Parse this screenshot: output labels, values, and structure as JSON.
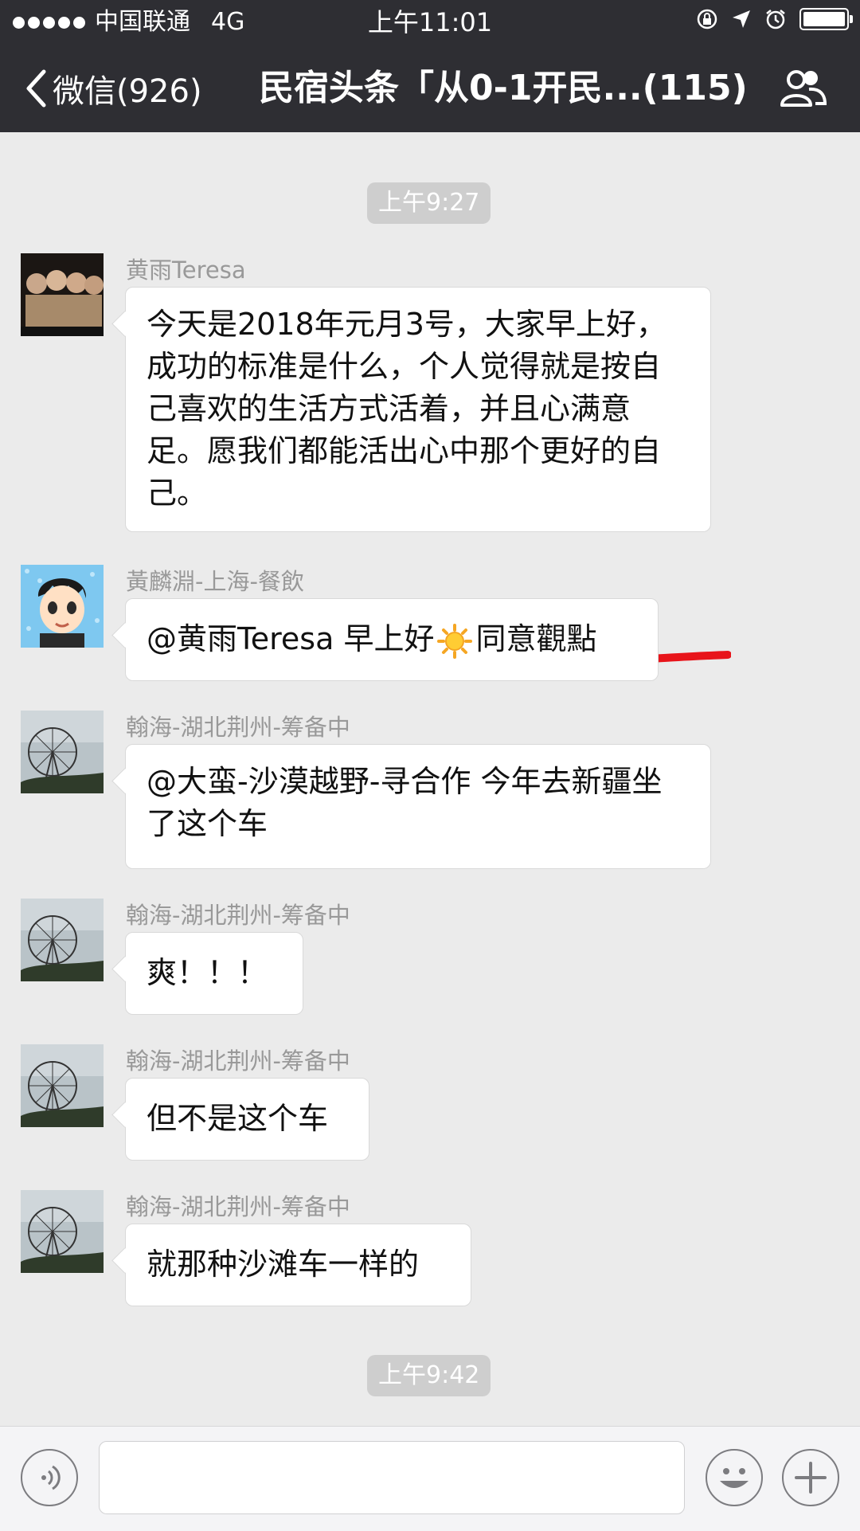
{
  "status_bar": {
    "carrier": "中国联通",
    "network": "4G",
    "time": "上午11:01"
  },
  "nav": {
    "back_label": "微信(926)",
    "title": "民宿头条「从0-1开民...(115)"
  },
  "timestamps": [
    "上午9:27",
    "上午9:42"
  ],
  "messages": [
    {
      "sender": "黄雨Teresa",
      "text": "今天是2018年元月3号，大家早上好，成功的标准是什么，个人觉得就是按自己喜欢的生活方式活着，并且心满意足。愿我们都能活出心中那个更好的自己。"
    },
    {
      "sender": "黃麟淵-上海-餐飲",
      "text_before": "@黄雨Teresa 早上好",
      "icon": "sun-emoji-icon",
      "text_after": "同意觀點"
    },
    {
      "sender": "翰海-湖北荆州-筹备中",
      "text": "@大蛮-沙漠越野-寻合作 今年去新疆坐了这个车"
    },
    {
      "sender": "翰海-湖北荆州-筹备中",
      "text": "爽！！！"
    },
    {
      "sender": "翰海-湖北荆州-筹备中",
      "text": "但不是这个车"
    },
    {
      "sender": "翰海-湖北荆州-筹备中",
      "text": "就那种沙滩车一样的"
    }
  ],
  "colors": {
    "header_bg": "#2e2e33",
    "chat_bg": "#ebebeb",
    "bubble_bg": "#ffffff",
    "highlight_stroke": "#e8141a"
  }
}
